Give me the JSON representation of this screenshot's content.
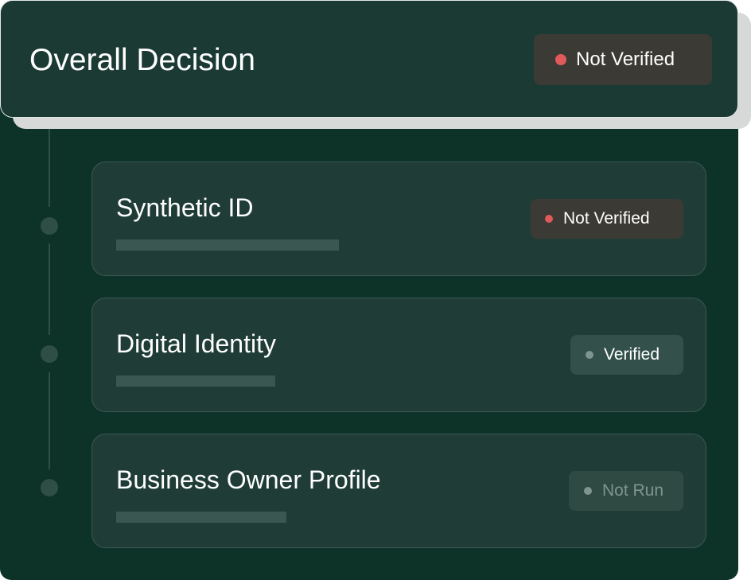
{
  "header": {
    "title": "Overall Decision",
    "status": {
      "label": "Not Verified",
      "color": "#e05a5a"
    }
  },
  "checks": [
    {
      "title": "Synthetic ID",
      "status": "Not Verified",
      "status_color": "#e05a5a"
    },
    {
      "title": "Digital Identity",
      "status": "Verified",
      "status_color": "#7e948e"
    },
    {
      "title": "Business Owner Profile",
      "status": "Not Run",
      "status_color": "#7f958f"
    }
  ],
  "colors": {
    "panel_background": "#0d3329",
    "header_background": "#1a3a33",
    "card_background": "#1f3d36"
  }
}
